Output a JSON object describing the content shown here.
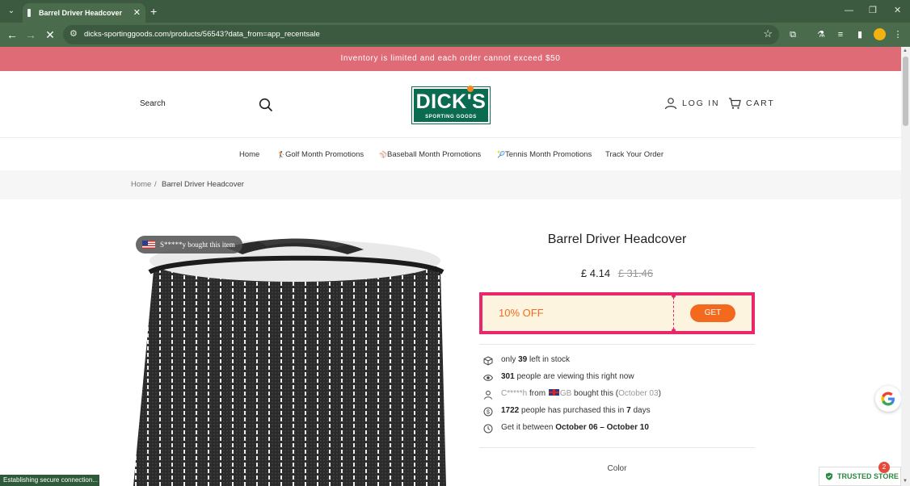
{
  "browser": {
    "tab_title": "Barrel Driver Headcover",
    "tab_close": "✕",
    "new_tab": "+",
    "url": "dicks-sportinggoods.com/products/56543?data_from=app_recentsale",
    "controls": {
      "minimize": "—",
      "restore": "❐",
      "close": "✕"
    },
    "status_text": "Establishing secure connection..."
  },
  "announcement": "Inventory is limited and each order cannot exceed $50",
  "header": {
    "search_label": "Search",
    "logo_top": "DICK'S",
    "logo_bottom": "SPORTING GOODS",
    "login_label": "LOG IN",
    "cart_label": "CART"
  },
  "nav": {
    "items": [
      {
        "label": "Home"
      },
      {
        "label": "Golf Month Promotions",
        "emoji": "🏌"
      },
      {
        "label": "Baseball Month Promotions",
        "emoji": "⚾"
      },
      {
        "label": "Tennis Month Promotions",
        "emoji": "🎾"
      },
      {
        "label": "Track Your Order"
      }
    ]
  },
  "breadcrumb": {
    "home": "Home",
    "separator": "/",
    "current": "Barrel Driver Headcover"
  },
  "product": {
    "bought_badge": "S*****y bought this item",
    "title": "Barrel Driver Headcover",
    "price_now": "£ 4.14",
    "price_old": "£ 31.46",
    "coupon": {
      "discount": "10% OFF",
      "button": "GET"
    },
    "stats": {
      "stock": {
        "pre": "only ",
        "count": "39",
        "post": " left in stock"
      },
      "viewing": {
        "count": "301",
        "post": " people are viewing this right now"
      },
      "recent": {
        "name": "C*****h",
        "from": " from ",
        "country": "GB",
        "mid": " bought this (",
        "date": "October 03",
        "close": ")"
      },
      "purchased": {
        "count": "1722",
        "mid": " people has purchased this in ",
        "days": "7",
        "post": " days"
      },
      "delivery": {
        "pre": "Get it between ",
        "start": "October 06",
        "sep": " – ",
        "end": "October 10"
      }
    },
    "color_label": "Color"
  },
  "widgets": {
    "trusted_label": "TRUSTED STORE",
    "trusted_badge": "2"
  },
  "colors": {
    "brand_green": "#0b6b51",
    "announce": "#df6b77",
    "coupon_border": "#e8286a",
    "coupon_accent": "#f36a1e"
  }
}
